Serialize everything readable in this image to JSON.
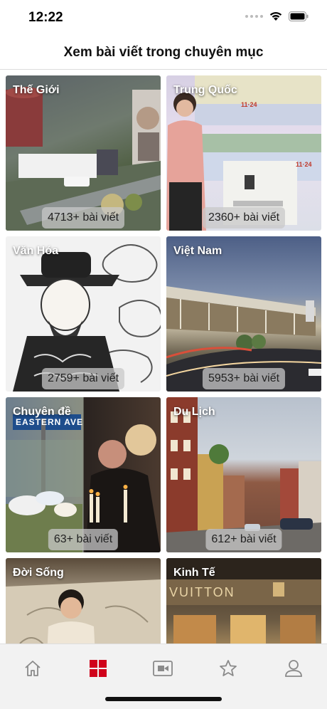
{
  "status_bar": {
    "time": "12:22"
  },
  "header": {
    "title": "Xem bài viết trong chuyên mục"
  },
  "categories": [
    {
      "title": "Thế Giới",
      "count": "4713+ bài viết"
    },
    {
      "title": "Trung Quốc",
      "count": "2360+ bài viết"
    },
    {
      "title": "Văn Hóa",
      "count": "2759+ bài viết"
    },
    {
      "title": "Việt Nam",
      "count": "5953+ bài viết"
    },
    {
      "title": "Chuyên đề",
      "count": "63+ bài viết"
    },
    {
      "title": "Du Lịch",
      "count": "612+ bài viết"
    },
    {
      "title": "Đời Sống",
      "count": ""
    },
    {
      "title": "Kinh Tế",
      "count": ""
    }
  ],
  "image_text": {
    "trungquoc_banner_1": "11·24",
    "trungquoc_banner_2": "11·24",
    "chuyende_sign": "EASTERN AVE",
    "kinhte_sign": "VUITTON"
  },
  "tab_bar": {
    "items": [
      {
        "icon": "home-icon",
        "active": false
      },
      {
        "icon": "grid-icon",
        "active": true
      },
      {
        "icon": "video-icon",
        "active": false
      },
      {
        "icon": "star-icon",
        "active": false
      },
      {
        "icon": "profile-icon",
        "active": false
      }
    ],
    "active_color": "#d0021b",
    "inactive_color": "#8a8a8a"
  }
}
